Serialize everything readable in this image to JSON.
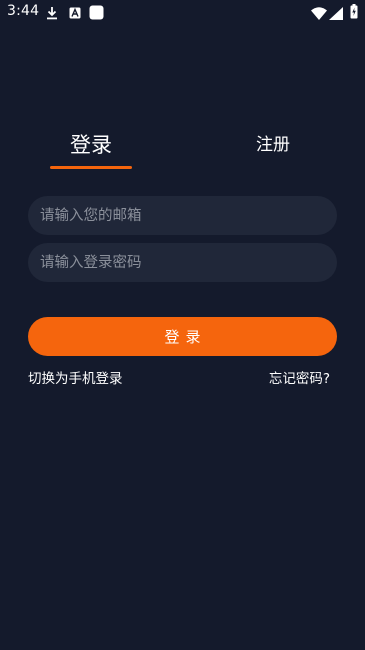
{
  "status_bar": {
    "time": "3:44",
    "icons": [
      "download-icon",
      "a-badge-icon",
      "app-square-icon",
      "wifi-icon",
      "cell-signal-icon",
      "battery-charging-icon"
    ]
  },
  "tabs": {
    "login": "登录",
    "register": "注册",
    "active": "login"
  },
  "form": {
    "email_placeholder": "请输入您的邮箱",
    "email_value": "",
    "password_placeholder": "请输入登录密码",
    "password_value": ""
  },
  "actions": {
    "login_button": "登录",
    "switch_phone_login": "切换为手机登录",
    "forgot_password": "忘记密码?"
  },
  "colors": {
    "background": "#141a2c",
    "input_background": "#202739",
    "accent": "#f5650d",
    "placeholder": "#8b909b"
  }
}
